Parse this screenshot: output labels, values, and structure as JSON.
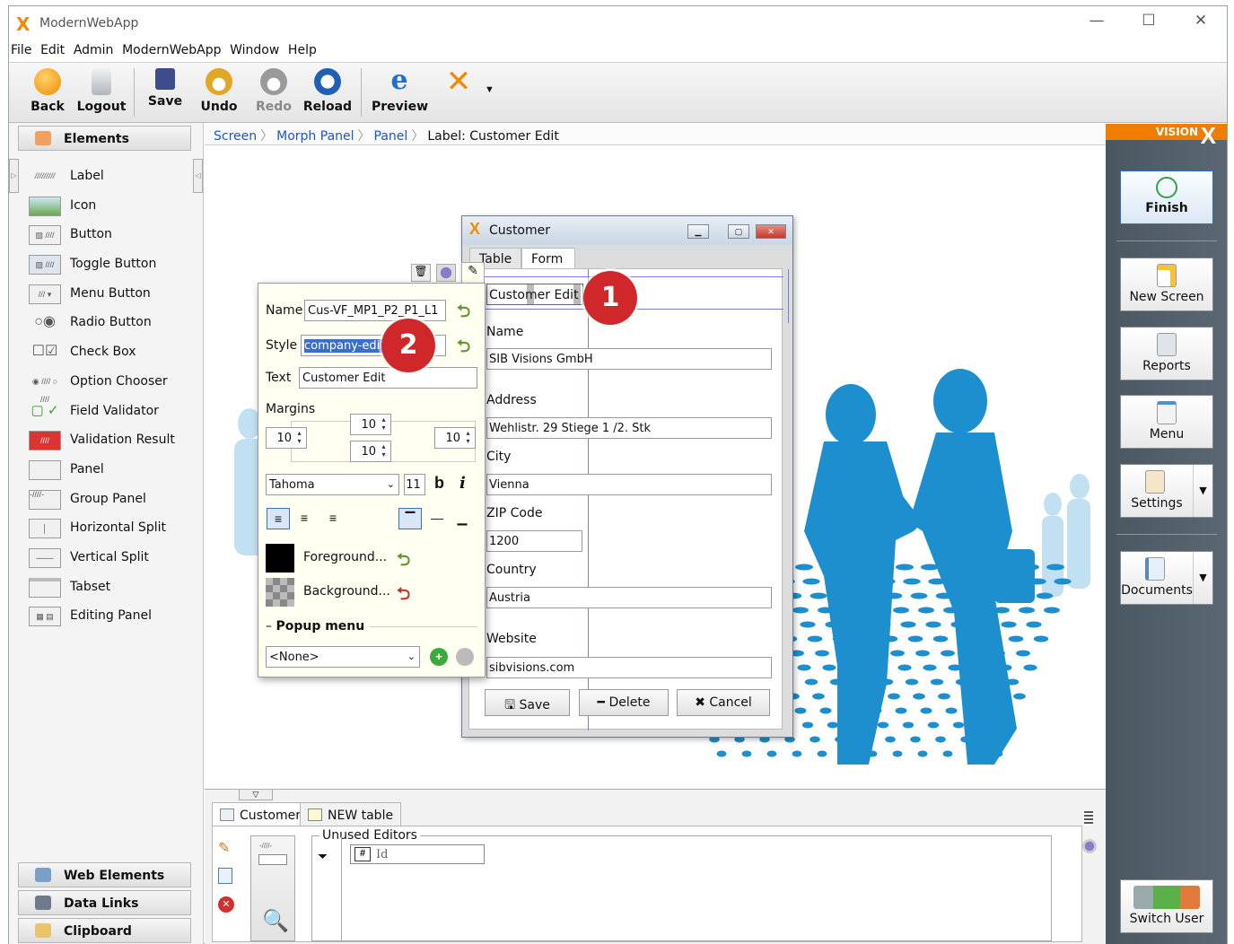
{
  "app": {
    "title": "ModernWebApp",
    "logo": "X"
  },
  "window_controls": {
    "minimize": "—",
    "maximize": "☐",
    "close": "✕"
  },
  "menu": [
    "File",
    "Edit",
    "Admin",
    "ModernWebApp",
    "Window",
    "Help"
  ],
  "toolbar": {
    "back": "Back",
    "logout": "Logout",
    "save": "Save",
    "undo": "Undo",
    "redo": "Redo",
    "reload": "Reload",
    "preview": "Preview"
  },
  "left_panel": {
    "elements_header": "Elements",
    "palette": [
      "Label",
      "Icon",
      "Button",
      "Toggle Button",
      "Menu Button",
      "Radio Button",
      "Check Box",
      "Option Chooser",
      "Field Validator",
      "Validation Result",
      "Panel",
      "Group Panel",
      "Horizontal Split",
      "Vertical Split",
      "Tabset",
      "Editing Panel"
    ],
    "web_elements": "Web Elements",
    "data_links": "Data Links",
    "clipboard": "Clipboard"
  },
  "breadcrumb": [
    "Screen",
    "Morph Panel",
    "Panel",
    "Label: Customer Edit"
  ],
  "right_panel": {
    "brand": "VISION",
    "brand_x": "X",
    "finish": "Finish",
    "new_screen": "New Screen",
    "reports": "Reports",
    "menu": "Menu",
    "settings": "Settings",
    "documents": "Documents",
    "switch_user": "Switch User"
  },
  "customer_window": {
    "title": "Customer",
    "tabs": [
      "Table",
      "Form"
    ],
    "header_label": "Customer Edit",
    "fields": [
      {
        "label": "Name",
        "value": "SIB Visions GmbH"
      },
      {
        "label": "Address",
        "value": "Wehlistr. 29 Stiege 1 /2. Stk"
      },
      {
        "label": "City",
        "value": "Vienna"
      },
      {
        "label": "ZIP Code",
        "value": "1200"
      },
      {
        "label": "Country",
        "value": "Austria"
      },
      {
        "label": "Website",
        "value": "sibvisions.com"
      }
    ],
    "buttons": {
      "save": "Save",
      "delete": "Delete",
      "cancel": "Cancel"
    }
  },
  "properties": {
    "name_label": "Name",
    "name_value": "Cus-VF_MP1_P2_P1_L1",
    "style_label": "Style",
    "style_value": "company-edit",
    "text_label": "Text",
    "text_value": "Customer Edit",
    "margins_label": "Margins",
    "margin_top": "10",
    "margin_left": "10",
    "margin_bottom": "10",
    "margin_right": "10",
    "font": "Tahoma",
    "font_size": "11",
    "bold": "b",
    "italic": "i",
    "foreground": "Foreground...",
    "background": "Background...",
    "popup_menu_label": "Popup menu",
    "popup_menu_value": "<None>"
  },
  "badges": [
    "1",
    "2"
  ],
  "bottom_panel": {
    "tabs": [
      "Customer",
      "NEW table"
    ],
    "unused_editors": "Unused Editors",
    "editor_item": "Id"
  },
  "colors": {
    "accent": "#f07c00",
    "link": "#1a55c9",
    "badge": "#d0282a",
    "silhouette": "#1a8fd0"
  }
}
